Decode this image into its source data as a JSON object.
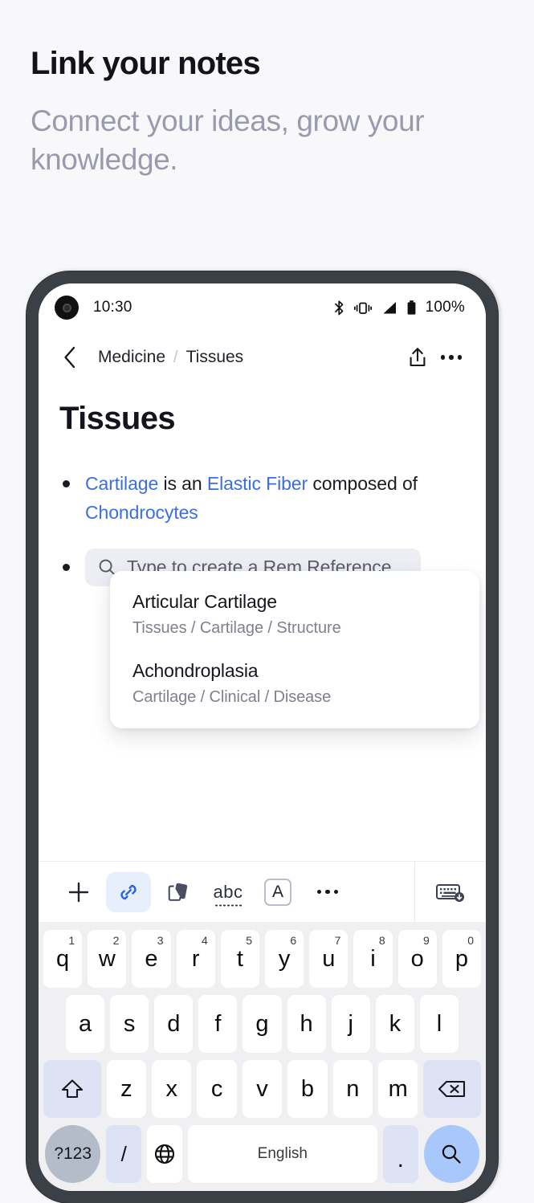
{
  "promo": {
    "title": "Link your notes",
    "subtitle": "Connect your ideas, grow your knowledge."
  },
  "colors": {
    "page_bg": "#f8f8fa",
    "promo_title": "#13131c",
    "promo_sub": "#9a9aae",
    "phone_bezel": "#3a4045",
    "link_blue": "#3b6fe0",
    "accent_blue": "#2563eb",
    "accent_blue_bg": "#e7eefc",
    "enter_key_blue": "#a8c7fa",
    "mod_key_blue": "#dde2f5",
    "keyboard_bg": "#f0f0f3",
    "chip_bg": "#eceef4"
  },
  "status_bar": {
    "time": "10:30",
    "battery_percent": "100%",
    "icons": [
      "bluetooth-icon",
      "vibrate-icon",
      "signal-icon",
      "battery-icon"
    ]
  },
  "nav": {
    "back_icon": "chevron-left-icon",
    "breadcrumb": [
      {
        "label": "Medicine"
      },
      {
        "label": "Tissues"
      }
    ],
    "separator": "/",
    "share_icon": "share-icon",
    "more_icon": "more-horizontal-icon"
  },
  "note": {
    "title": "Tissues",
    "bullets": [
      {
        "segments": [
          {
            "text": "Cartilage",
            "link": true
          },
          {
            "text": " is an ",
            "link": false
          },
          {
            "text": "Elastic Fiber",
            "link": true
          },
          {
            "text": " composed of ",
            "link": false
          },
          {
            "text": "Chondrocytes",
            "link": true
          }
        ]
      }
    ],
    "search_chip": {
      "icon": "search-icon",
      "placeholder": "Type to create a Rem Reference",
      "value": ""
    }
  },
  "suggestions": [
    {
      "title": "Articular Cartilage",
      "path": "Tissues / Cartilage / Structure"
    },
    {
      "title": "Achondroplasia",
      "path": "Cartilage / Clinical / Disease"
    }
  ],
  "toolbar": {
    "items": [
      {
        "name": "add-button",
        "icon": "plus-icon",
        "active": false
      },
      {
        "name": "link-button",
        "icon": "link-icon",
        "active": true
      },
      {
        "name": "flashcard-button",
        "icon": "cards-icon",
        "active": false
      },
      {
        "name": "spellcheck-button",
        "icon": "abc-icon",
        "active": false,
        "label": "abc"
      },
      {
        "name": "format-button",
        "icon": "font-a-icon",
        "active": false,
        "label": "A"
      },
      {
        "name": "more-button",
        "icon": "more-horizontal-icon",
        "active": false
      }
    ],
    "hide_keyboard": {
      "name": "hide-keyboard-button",
      "icon": "keyboard-hide-icon"
    }
  },
  "keyboard": {
    "row1": [
      {
        "key": "q",
        "sup": "1"
      },
      {
        "key": "w",
        "sup": "2"
      },
      {
        "key": "e",
        "sup": "3"
      },
      {
        "key": "r",
        "sup": "4"
      },
      {
        "key": "t",
        "sup": "5"
      },
      {
        "key": "y",
        "sup": "6"
      },
      {
        "key": "u",
        "sup": "7"
      },
      {
        "key": "i",
        "sup": "8"
      },
      {
        "key": "o",
        "sup": "9"
      },
      {
        "key": "p",
        "sup": "0"
      }
    ],
    "row2": [
      {
        "key": "a"
      },
      {
        "key": "s"
      },
      {
        "key": "d"
      },
      {
        "key": "f"
      },
      {
        "key": "g"
      },
      {
        "key": "h"
      },
      {
        "key": "j"
      },
      {
        "key": "k"
      },
      {
        "key": "l"
      }
    ],
    "row3": [
      {
        "key": "z"
      },
      {
        "key": "x"
      },
      {
        "key": "c"
      },
      {
        "key": "v"
      },
      {
        "key": "b"
      },
      {
        "key": "n"
      },
      {
        "key": "m"
      }
    ],
    "shift_icon": "shift-icon",
    "backspace_icon": "backspace-icon",
    "row4": {
      "symbols_label": "?123",
      "slash_label": "/",
      "globe_icon": "globe-icon",
      "space_label": "English",
      "period_label": ".",
      "enter_icon": "search-icon"
    }
  }
}
